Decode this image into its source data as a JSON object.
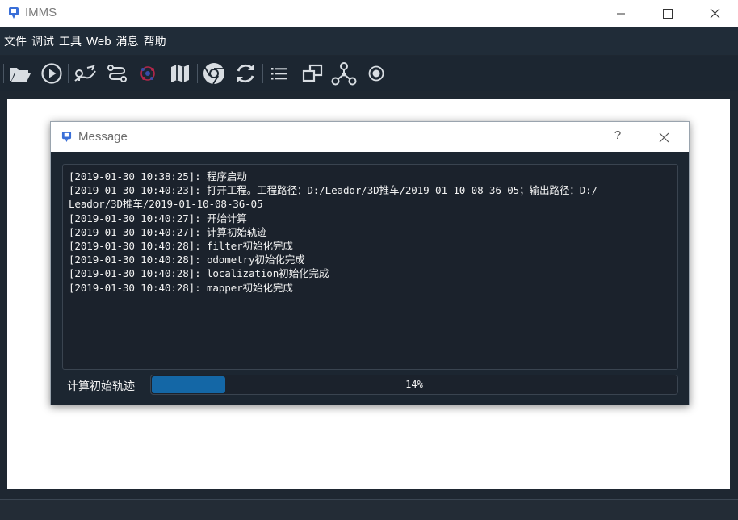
{
  "window": {
    "title": "IMMS",
    "controls": [
      "minimize",
      "maximize",
      "close"
    ]
  },
  "menu": {
    "items": [
      "文件",
      "调试",
      "工具",
      "Web",
      "消息",
      "帮助"
    ]
  },
  "toolbar": {
    "icons": [
      "folder-open-icon",
      "play-icon",
      "route-icon",
      "path-icon",
      "network-icon",
      "map-icon",
      "chrome-icon",
      "refresh-icon",
      "list-icon",
      "windows-icon",
      "graph-icon",
      "record-icon"
    ]
  },
  "dialog": {
    "title": "Message",
    "help": "?",
    "log": [
      "[2019-01-30 10:38:25]: 程序启动",
      "[2019-01-30 10:40:23]: 打开工程。工程路径：D:/Leador/3D推车/2019-01-10-08-36-05；输出路径：D:/",
      "Leador/3D推车/2019-01-10-08-36-05",
      "[2019-01-30 10:40:27]: 开始计算",
      "[2019-01-30 10:40:27]: 计算初始轨迹",
      "[2019-01-30 10:40:28]: filter初始化完成",
      "[2019-01-30 10:40:28]: odometry初始化完成",
      "[2019-01-30 10:40:28]: localization初始化完成",
      "[2019-01-30 10:40:28]: mapper初始化完成"
    ],
    "progress": {
      "label": "计算初始轨迹",
      "percent": 14,
      "text": "14%"
    }
  },
  "colors": {
    "accent": "#1467a6",
    "background": "#1e2731",
    "toolbar": "#1c2631"
  }
}
